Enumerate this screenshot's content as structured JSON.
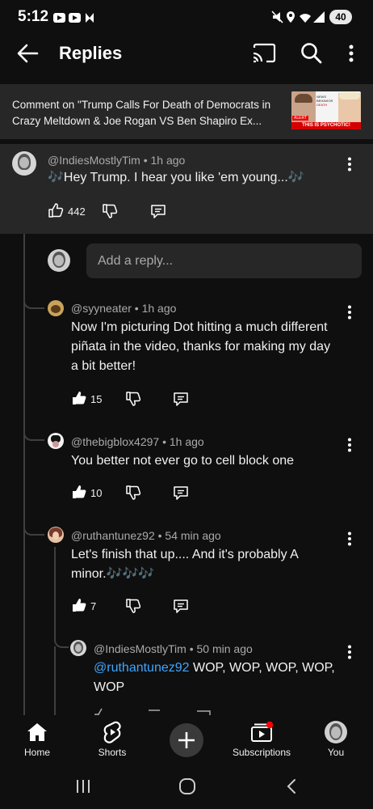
{
  "status_bar": {
    "time": "5:12",
    "battery": "40"
  },
  "header": {
    "title": "Replies"
  },
  "video": {
    "context": "Comment on \"Trump Calls For Death of Democrats in Crazy Meltdown & Joe Rogan VS Ben Shapiro Ex...",
    "thumb_line1": "NEWS",
    "thumb_line2": "BEHAVIOR",
    "thumb_line3": "DEATH",
    "thumb_alert": "ALERT",
    "thumb_banner": "THIS IS PSYCHOTIC!"
  },
  "main_comment": {
    "author": "@IndiesMostlyTim • 1h ago",
    "text": "🎶Hey Trump. I hear you like 'em young...🎶",
    "likes": "442"
  },
  "reply_input": {
    "placeholder": "Add a reply..."
  },
  "replies": [
    {
      "author": "@syyneater • 1h ago",
      "line1": "Now I'm picturing Dot hitting a much different",
      "line2": "piñata in the video, thanks for making my day",
      "line3": "a bit better!",
      "likes": "15"
    },
    {
      "author": "@thebigblox4297 • 1h ago",
      "line1": "You better not ever go to cell block one",
      "likes": "10"
    },
    {
      "author": "@ruthantunez92 • 54 min ago",
      "line1": "Let's finish that up.... And it's probably A",
      "line2": "minor.🎶🎶🎶",
      "likes": "7"
    },
    {
      "author": "@IndiesMostlyTim • 50 min ago",
      "mention": "@ruthantunez92",
      "line1": " WOP, WOP, WOP, WOP,",
      "line2": "WOP"
    }
  ],
  "nav": {
    "home": "Home",
    "shorts": "Shorts",
    "subscriptions": "Subscriptions",
    "you": "You"
  },
  "colors": {
    "background": "#0f0f0f",
    "panel": "#272727",
    "mention": "#3ea6ff",
    "notification": "#ff0000"
  }
}
